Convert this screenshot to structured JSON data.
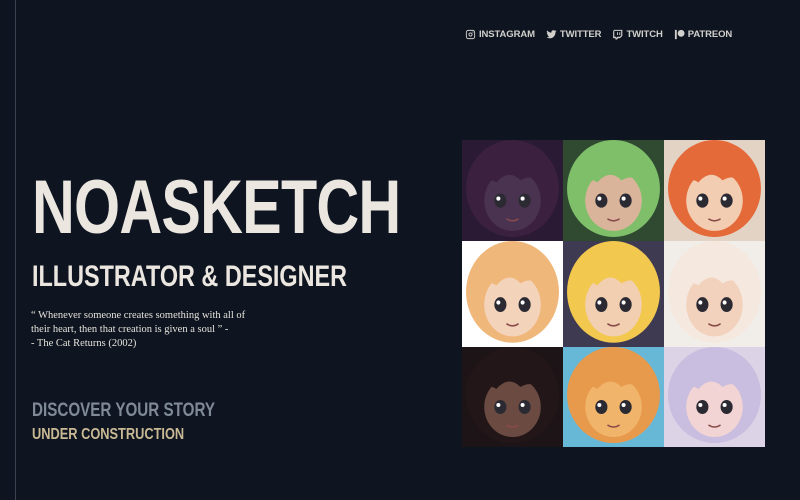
{
  "social": [
    {
      "label": "INSTAGRAM",
      "icon": "instagram-icon"
    },
    {
      "label": "TWITTER",
      "icon": "twitter-icon"
    },
    {
      "label": "TWITCH",
      "icon": "twitch-icon"
    },
    {
      "label": "PATREON",
      "icon": "patreon-icon"
    }
  ],
  "hero": {
    "title": "NOASKETCH",
    "subtitle": "ILLUSTRATOR & DESIGNER",
    "quote_line1": "“ Whenever someone creates something with all of their heart, then that creation is given a soul ” -",
    "quote_line2": "- The Cat Returns (2002)"
  },
  "footer": {
    "discover": "DISCOVER YOUR STORY",
    "status": "UNDER CONSTRUCTION"
  },
  "colors": {
    "background": "#0e1520",
    "text": "#ebe6e0",
    "discover": "#7f8a96",
    "status": "#c9b994"
  },
  "gallery": [
    {
      "name": "portrait-witch-hat",
      "bg": "#2a1a33",
      "skin": "#4a3350",
      "hair": "#3b2040"
    },
    {
      "name": "portrait-green-hair",
      "bg": "#2f4a30",
      "skin": "#d9b49a",
      "hair": "#7fbf6a"
    },
    {
      "name": "portrait-orange-hair",
      "bg": "#e2d3c4",
      "skin": "#f3cdb1",
      "hair": "#e56a3a"
    },
    {
      "name": "portrait-blonde-crying",
      "bg": "#ffffff",
      "skin": "#f4d3bb",
      "hair": "#f0b77a"
    },
    {
      "name": "portrait-sailor-blonde",
      "bg": "#3d3a52",
      "skin": "#f1cfb0",
      "hair": "#f2c84e"
    },
    {
      "name": "portrait-white-fluffy",
      "bg": "#f1ede8",
      "skin": "#f3d2bd",
      "hair": "#f5e9df"
    },
    {
      "name": "portrait-dark-hair",
      "bg": "#1c1416",
      "skin": "#6b4a42",
      "hair": "#231618"
    },
    {
      "name": "portrait-blue-dragon",
      "bg": "#67b7d6",
      "skin": "#f0b46a",
      "hair": "#e89a4c"
    },
    {
      "name": "portrait-lilac-hair",
      "bg": "#dcd3e6",
      "skin": "#f1d4d3",
      "hair": "#c9bde0"
    }
  ]
}
